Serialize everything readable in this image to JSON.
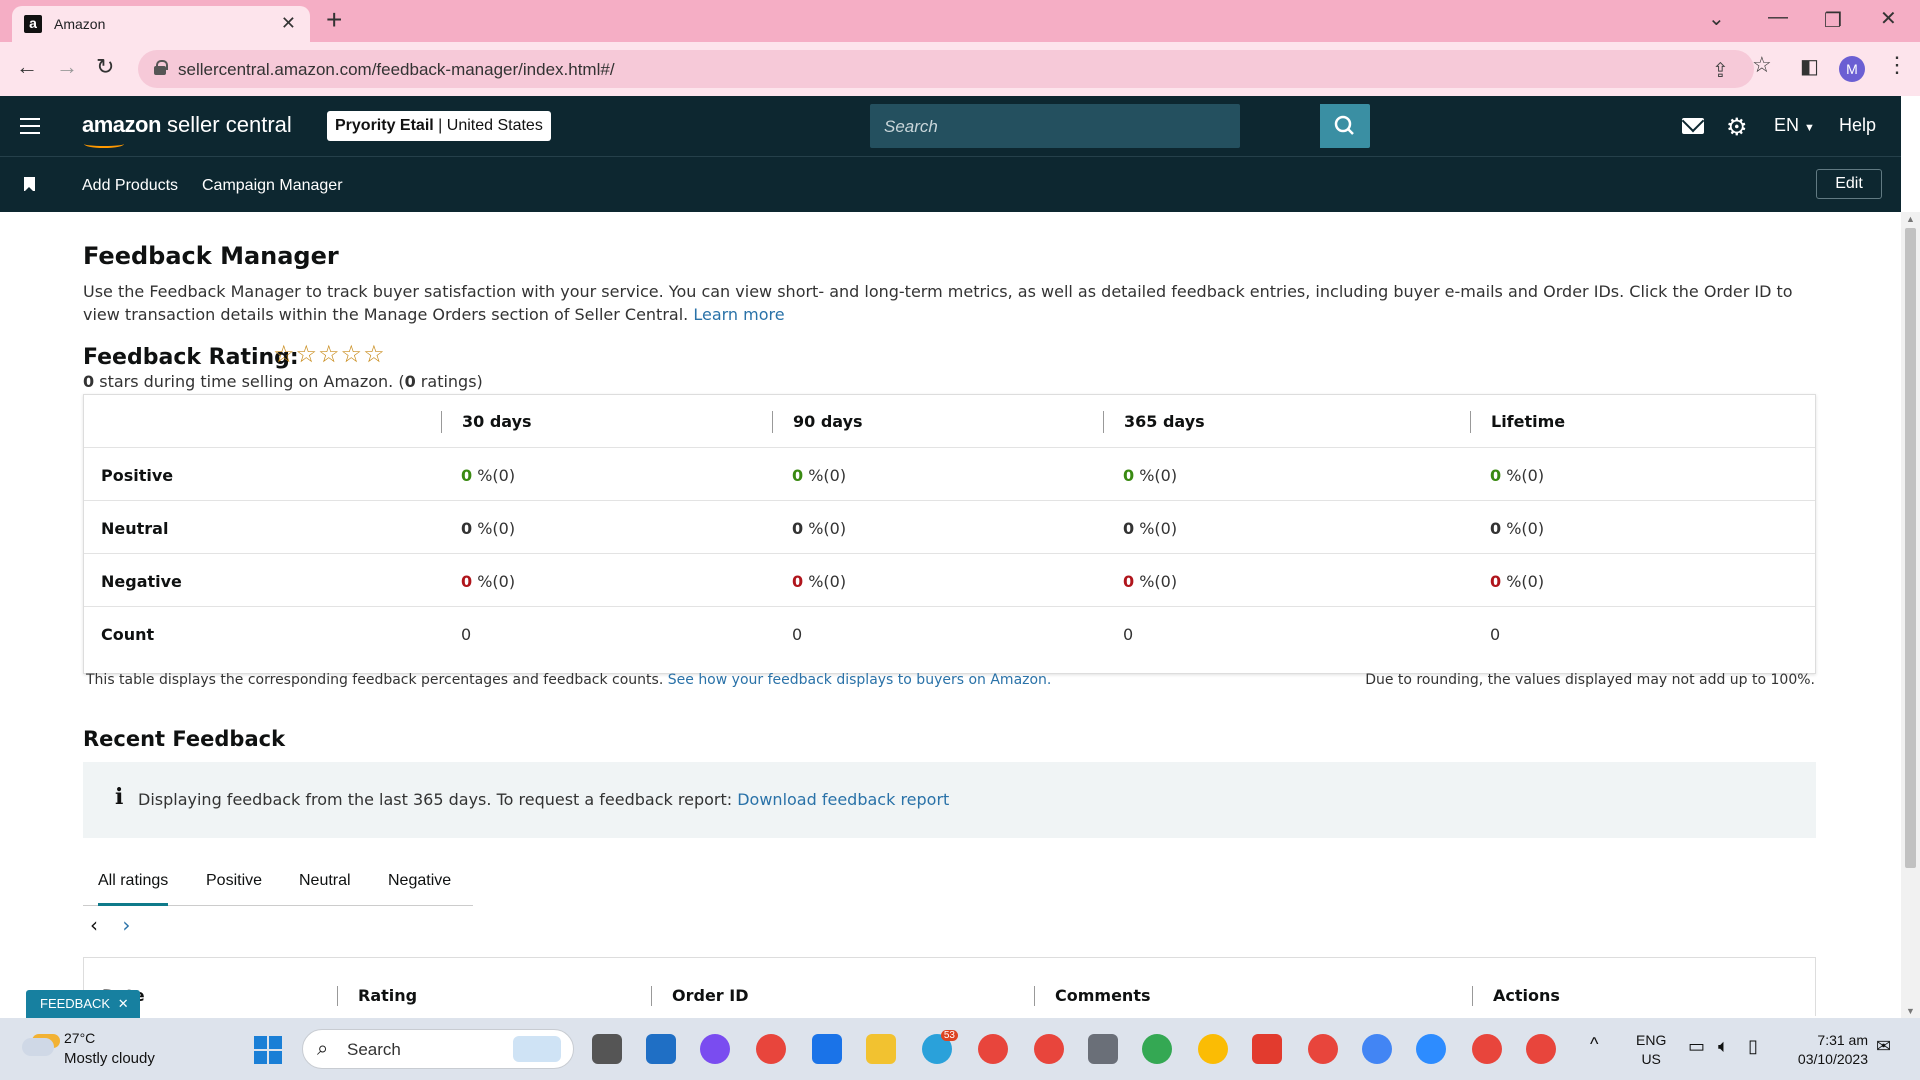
{
  "browser": {
    "tab_title": "Amazon",
    "favicon_letter": "a",
    "url": "sellercentral.amazon.com/feedback-manager/index.html#/",
    "profile_initial": "M"
  },
  "header": {
    "logo_brand": "amazon",
    "logo_product": "seller central",
    "store_name": "Pryority Etail",
    "store_region": "| United States",
    "search_placeholder": "Search",
    "language": "EN",
    "help": "Help"
  },
  "nav": {
    "links": [
      "Add Products",
      "Campaign Manager"
    ],
    "edit": "Edit"
  },
  "page": {
    "title": "Feedback Manager",
    "intro": "Use the Feedback Manager to track buyer satisfaction with your service. You can view short- and long-term metrics, as well as detailed feedback entries, including buyer e-mails and Order IDs. Click the Order ID to view transaction details within the Manage Orders section of Seller Central.",
    "learn_more": "Learn more",
    "rating_title": "Feedback Rating:",
    "stars": "☆☆☆☆☆",
    "rating_stars_value": "0",
    "rating_mid": " stars during time selling on Amazon. (",
    "rating_count_value": "0",
    "rating_end": " ratings)"
  },
  "feedback_table": {
    "columns": [
      "30 days",
      "90 days",
      "365 days",
      "Lifetime"
    ],
    "rows": [
      {
        "label": "Positive",
        "cells": [
          {
            "num": "0",
            "rest": " %(0)"
          },
          {
            "num": "0",
            "rest": " %(0)"
          },
          {
            "num": "0",
            "rest": " %(0)"
          },
          {
            "num": "0",
            "rest": " %(0)"
          }
        ]
      },
      {
        "label": "Neutral",
        "cells": [
          {
            "num": "0",
            "rest": " %(0)"
          },
          {
            "num": "0",
            "rest": " %(0)"
          },
          {
            "num": "0",
            "rest": " %(0)"
          },
          {
            "num": "0",
            "rest": " %(0)"
          }
        ]
      },
      {
        "label": "Negative",
        "cells": [
          {
            "num": "0",
            "rest": " %(0)"
          },
          {
            "num": "0",
            "rest": " %(0)"
          },
          {
            "num": "0",
            "rest": " %(0)"
          },
          {
            "num": "0",
            "rest": " %(0)"
          }
        ]
      },
      {
        "label": "Count",
        "cells": [
          "0",
          "0",
          "0",
          "0"
        ]
      }
    ],
    "note_left": "This table displays the corresponding feedback percentages and feedback counts.",
    "note_link": "See how your feedback displays to buyers on Amazon.",
    "note_right": "Due to rounding, the values displayed may not add up to 100%."
  },
  "recent": {
    "title": "Recent Feedback",
    "alert_icon": "i",
    "alert_text": "Displaying feedback from the last 365 days. To request a feedback report:",
    "alert_link": "Download feedback report",
    "tabs": [
      "All ratings",
      "Positive",
      "Neutral",
      "Negative"
    ],
    "table_columns": [
      "Date",
      "Rating",
      "Order ID",
      "Comments",
      "Actions"
    ]
  },
  "feedback_widget": "FEEDBACK",
  "taskbar": {
    "temperature": "27°C",
    "weather": "Mostly cloudy",
    "search": "Search",
    "telegram_badge": "53",
    "lang_line1": "ENG",
    "lang_line2": "US",
    "time": "7:31 am",
    "date": "03/10/2023"
  },
  "colors": {
    "header_bg": "#0d2730",
    "positive": "#3a8a12",
    "negative": "#b0151c",
    "link": "#2a72a8",
    "tab_strip": "#f5aec5"
  }
}
